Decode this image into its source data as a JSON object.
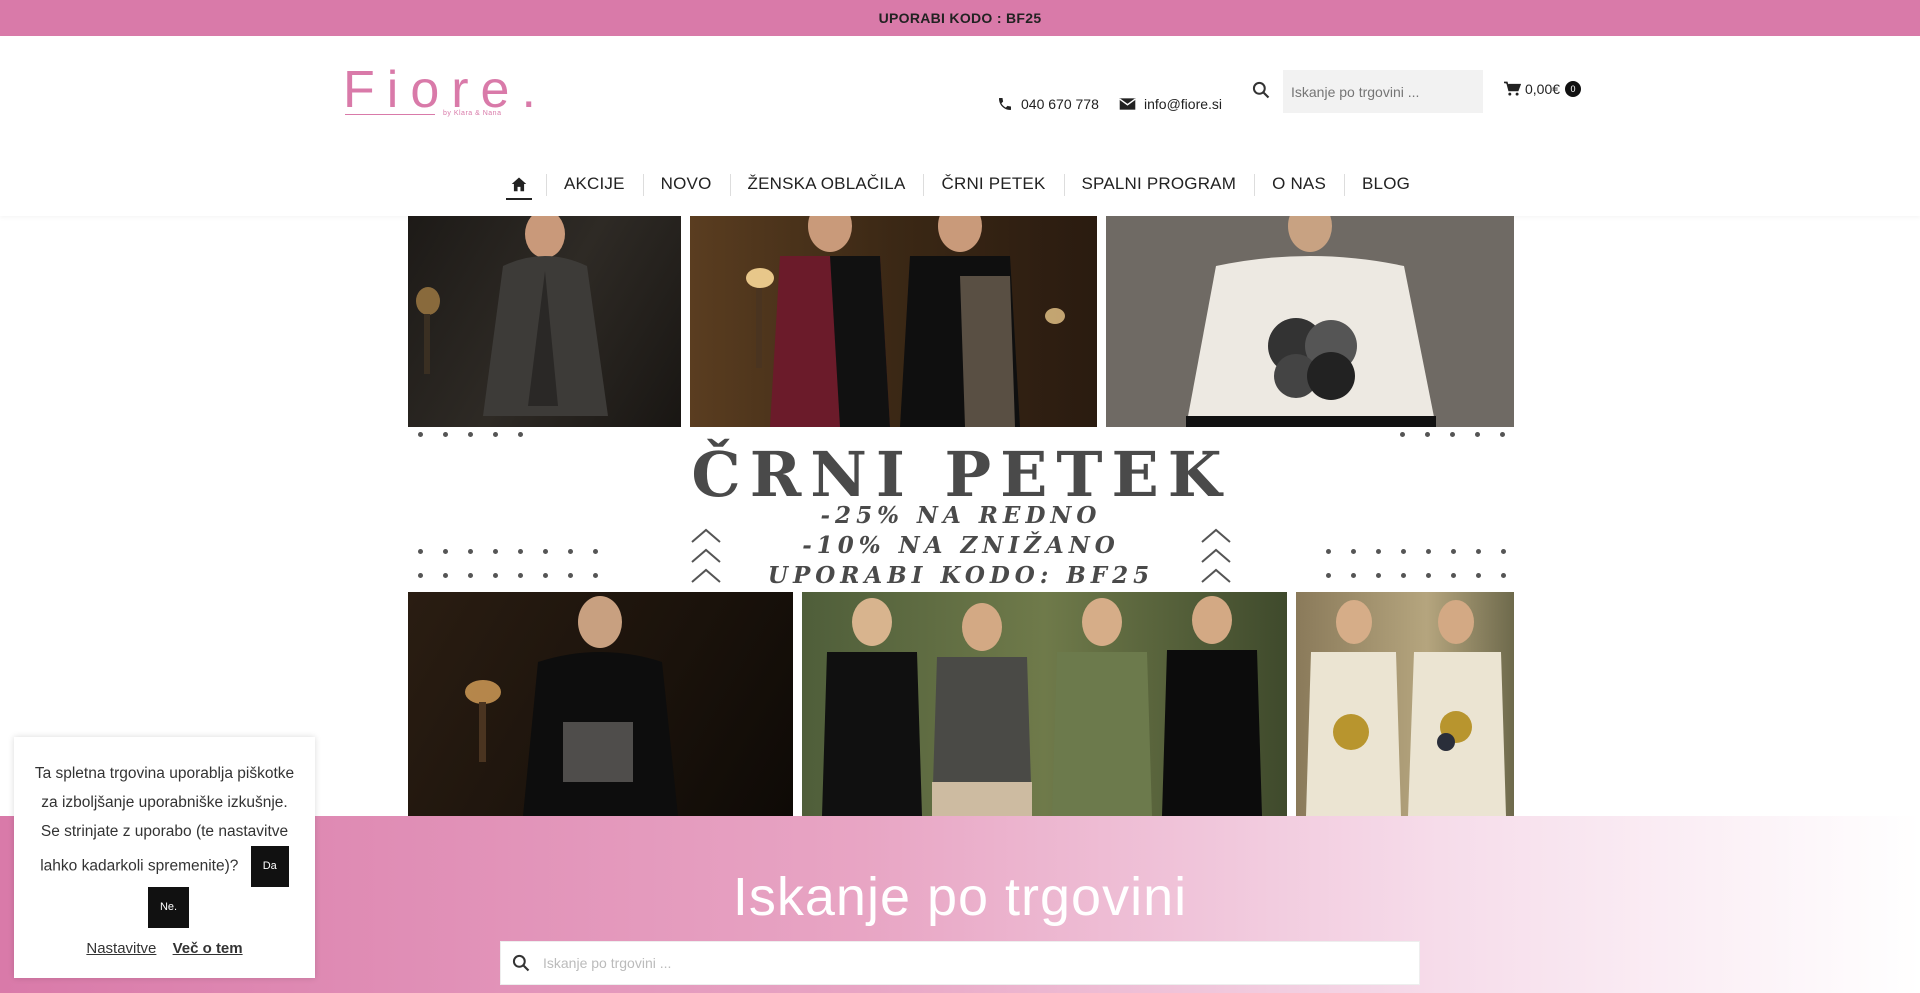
{
  "promo_bar": {
    "text": "UPORABI KODO : BF25"
  },
  "logo": {
    "word": "Fiore.",
    "tagline": "by Klara & Nana"
  },
  "header": {
    "phone": "040 670 778",
    "email": "info@fiore.si",
    "search_placeholder": "Iskanje po trgovini ...",
    "cart_total": "0,00€",
    "cart_count": "0"
  },
  "nav": {
    "home_icon": "home-icon",
    "items": [
      "AKCIJE",
      "NOVO",
      "ŽENSKA OBLAČILA",
      "ČRNI PETEK",
      "SPALNI PROGRAM",
      "O NAS",
      "BLOG"
    ]
  },
  "banner": {
    "title": "ČRNI PETEK",
    "line1": "-25% NA REDNO",
    "line2": "-10% NA ZNIŽANO",
    "line3": "UPORABI KODO: BF25"
  },
  "search_section": {
    "heading": "Iskanje po trgovini",
    "placeholder": "Iskanje po trgovini ..."
  },
  "cookie_notice": {
    "text": "Ta spletna trgovina uporablja piškotke za izboljšanje uporabniške izkušnje. Se strinjate z uporabo (te nastavitve lahko kadarkoli spremenite)?",
    "accept": "Da",
    "decline": "Ne.",
    "settings_link": "Nastavitve",
    "more_link": "Več o tem"
  },
  "colors": {
    "accent": "#d97aa9",
    "dark": "#222222"
  }
}
